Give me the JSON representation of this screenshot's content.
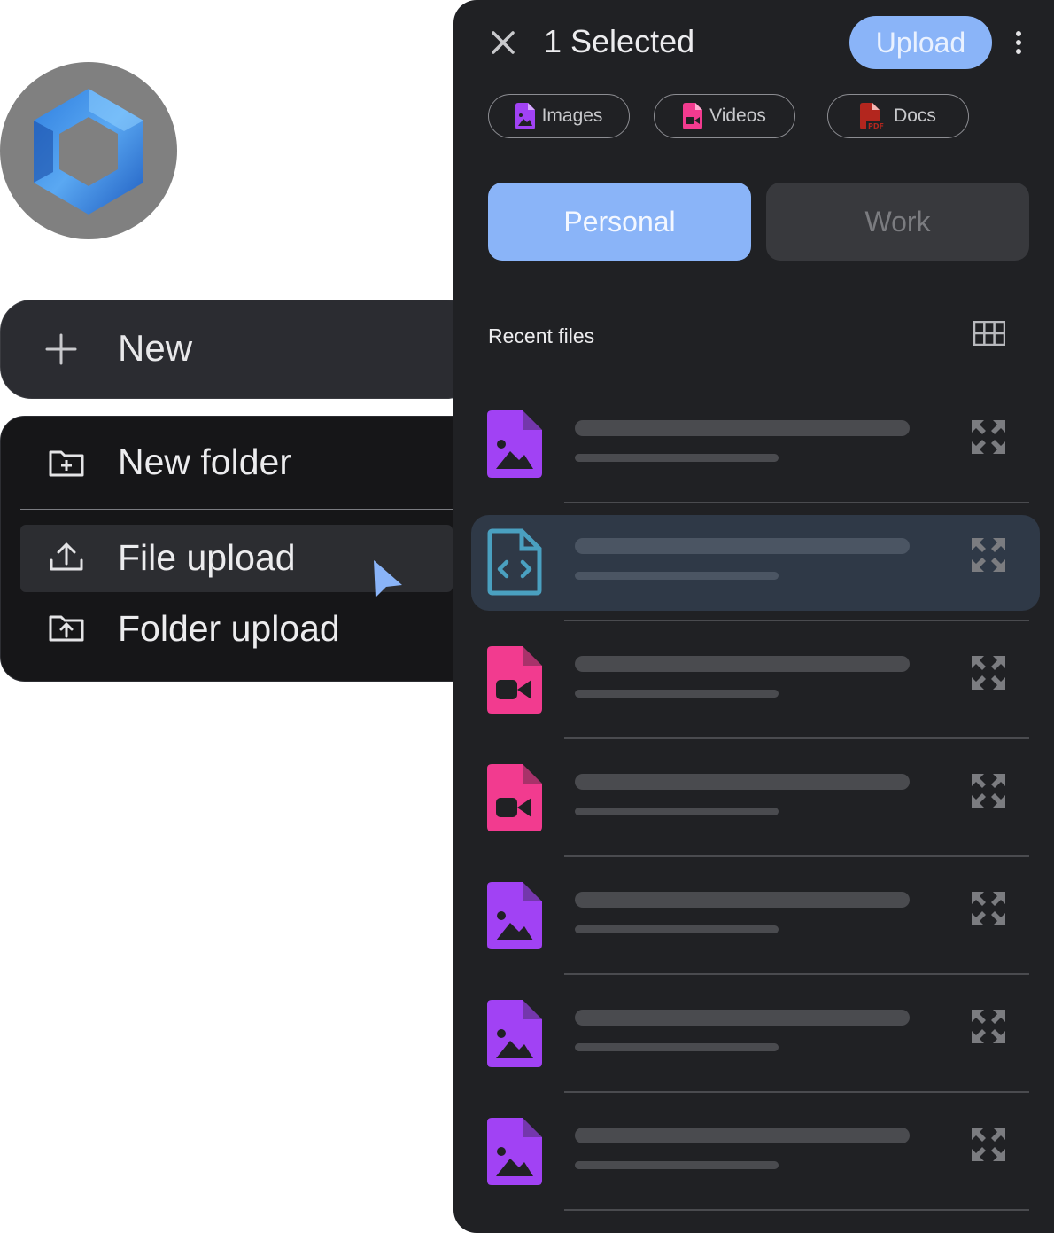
{
  "colors": {
    "accent": "#8ab4f8",
    "panel_bg": "#202124",
    "menu_bg": "#161618",
    "image_file": "#a142f4",
    "video_file": "#f23b8f",
    "pdf_file": "#b3261e",
    "code_file": "#4aa0c0"
  },
  "logo": {
    "icon": "hexagon-logo-icon"
  },
  "new_button": {
    "label": "New",
    "icon": "plus-icon"
  },
  "menu": {
    "items": [
      {
        "label": "New folder",
        "icon": "folder-plus-icon"
      },
      {
        "label": "File upload",
        "icon": "upload-icon"
      },
      {
        "label": "Folder upload",
        "icon": "folder-upload-icon"
      }
    ]
  },
  "panel": {
    "title": "1 Selected",
    "upload_label": "Upload",
    "filters": [
      {
        "label": "Images",
        "icon": "image-file-icon"
      },
      {
        "label": "Videos",
        "icon": "video-file-icon"
      },
      {
        "label": "Docs",
        "icon": "pdf-file-icon"
      }
    ],
    "tabs": {
      "personal": "Personal",
      "work": "Work"
    },
    "recent_label": "Recent files",
    "files": [
      {
        "type": "image",
        "icon": "image-file-icon",
        "selected": false
      },
      {
        "type": "code",
        "icon": "code-file-icon",
        "selected": true
      },
      {
        "type": "video",
        "icon": "video-file-icon",
        "selected": false
      },
      {
        "type": "video",
        "icon": "video-file-icon",
        "selected": false
      },
      {
        "type": "image",
        "icon": "image-file-icon",
        "selected": false
      },
      {
        "type": "image",
        "icon": "image-file-icon",
        "selected": false
      },
      {
        "type": "image",
        "icon": "image-file-icon",
        "selected": false
      }
    ]
  }
}
